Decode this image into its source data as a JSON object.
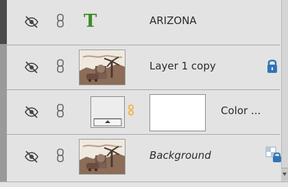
{
  "layers": [
    {
      "name": "ARIZONA",
      "kind": "type",
      "type_glyph": "T"
    },
    {
      "name": "Layer 1 copy",
      "kind": "image",
      "badge": "lock"
    },
    {
      "name": "Color ...",
      "kind": "adjustment",
      "badge": "none"
    },
    {
      "name": "Background",
      "kind": "image",
      "badge": "locked-transparency"
    }
  ],
  "colors": {
    "type_glyph": "#3d8a27",
    "lock_icon": "#2f75b5",
    "link_icon": "#f0b43a"
  }
}
